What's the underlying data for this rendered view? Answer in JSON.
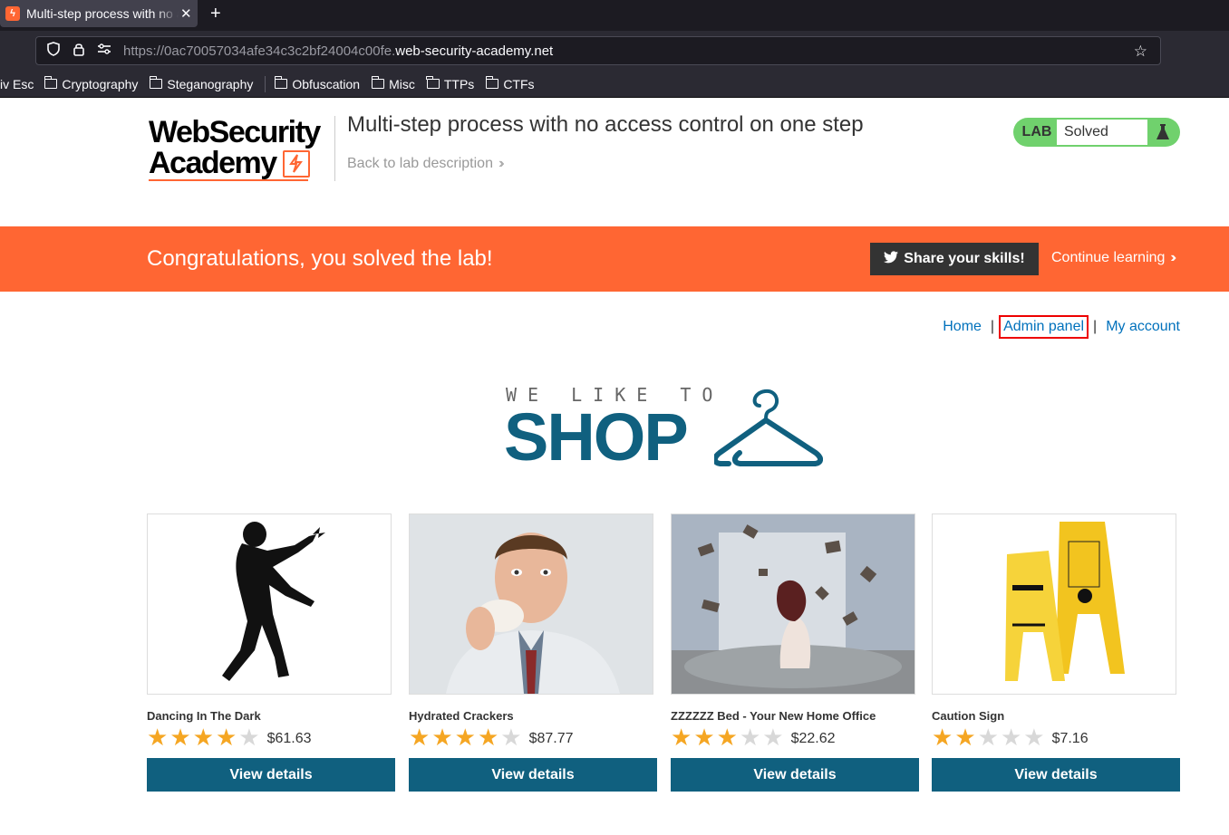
{
  "browser": {
    "tab_title": "Multi-step process with no access control on one step",
    "tab_favicon": "lightning-icon",
    "new_tab": "+",
    "url_dim": "https://0ac70057034afe34c3c2bf24004c00fe.",
    "url_domain": "web-security-academy.net",
    "bookmarks": [
      {
        "label": "iv Esc",
        "folder": false
      },
      {
        "label": "Cryptography",
        "folder": true
      },
      {
        "label": "Steganography",
        "folder": true
      },
      {
        "label": "Obfuscation",
        "folder": true
      },
      {
        "label": "Misc",
        "folder": true
      },
      {
        "label": "TTPs",
        "folder": true
      },
      {
        "label": "CTFs",
        "folder": true
      }
    ]
  },
  "header": {
    "logo_line1": "WebSecurity",
    "logo_line2": "Academy",
    "lab_title": "Multi-step process with no access control on one step",
    "back_link": "Back to lab description",
    "lab_badge": "LAB",
    "lab_status": "Solved"
  },
  "banner": {
    "message": "Congratulations, you solved the lab!",
    "share_button": "Share your skills!",
    "continue_link": "Continue learning"
  },
  "nav": {
    "home": "Home",
    "admin_panel": "Admin panel",
    "my_account": "My account",
    "separator": "|"
  },
  "shop": {
    "tagline": "WE LIKE TO",
    "word": "SHOP"
  },
  "products": [
    {
      "name": "Dancing In The Dark",
      "rating": 4,
      "price": "$61.63",
      "button": "View details"
    },
    {
      "name": "Hydrated Crackers",
      "rating": 4,
      "price": "$87.77",
      "button": "View details"
    },
    {
      "name": "ZZZZZZ Bed - Your New Home Office",
      "rating": 3,
      "price": "$22.62",
      "button": "View details"
    },
    {
      "name": "Caution Sign",
      "rating": 2,
      "price": "$7.16",
      "button": "View details"
    }
  ],
  "colors": {
    "brand_orange": "#ff6633",
    "button_blue": "#10607f",
    "link_blue": "#0071bc",
    "lab_green": "#70d16d",
    "star_gold": "#f5a623"
  }
}
